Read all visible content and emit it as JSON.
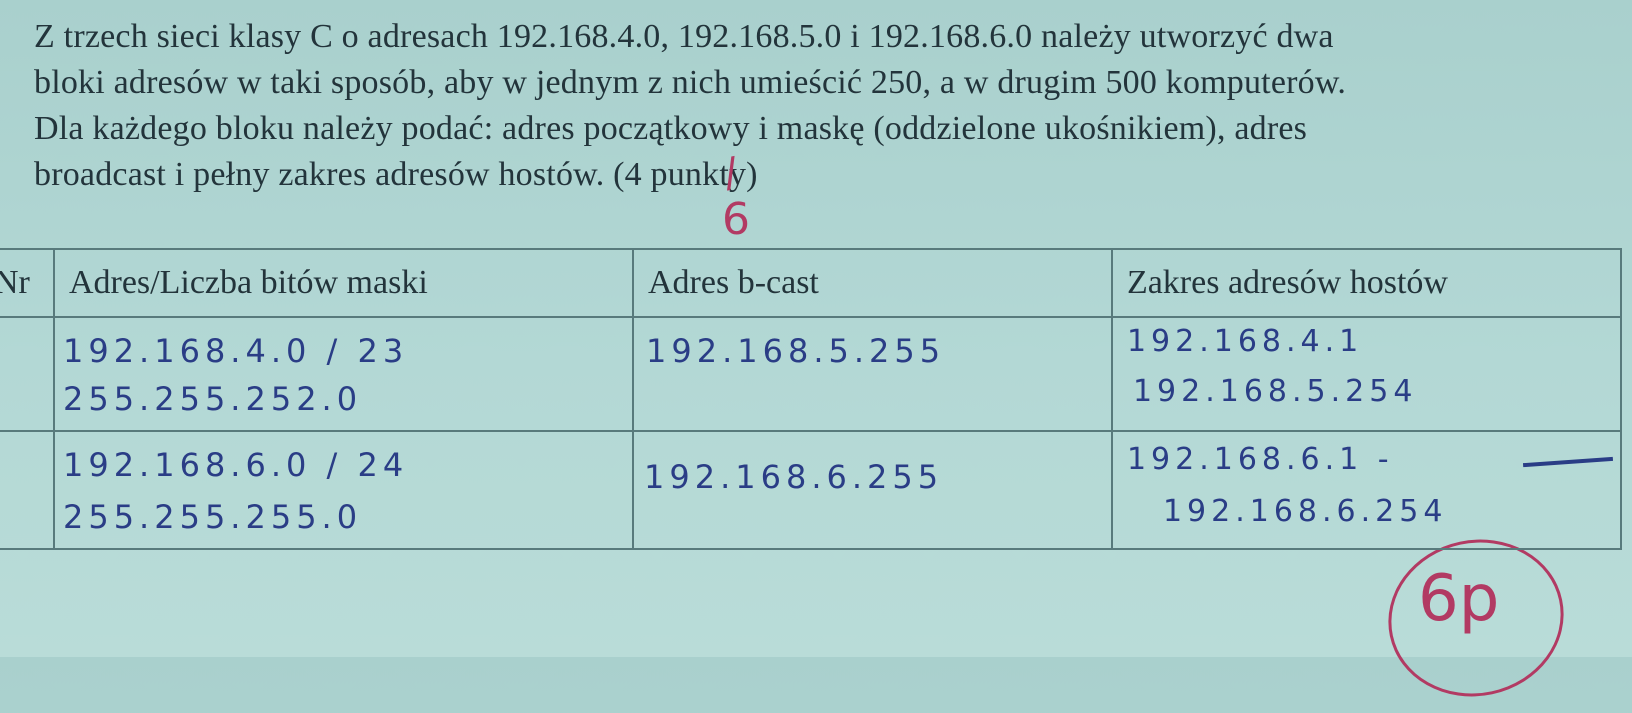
{
  "question": {
    "line1": "Z trzech sieci klasy C o adresach 192.168.4.0, 192.168.5.0 i 192.168.6.0 należy utworzyć dwa",
    "line2": "bloki adresów w taki sposób, aby w jednym z nich umieścić 250, a w drugim 500 komputerów.",
    "line3": "Dla każdego bloku należy podać: adres początkowy i maskę (oddzielone ukośnikiem), adres",
    "line4": "broadcast i pełny zakres adresów hostów. (4 punkty)"
  },
  "grading": {
    "points_correction": "6",
    "score_circled": "6p"
  },
  "table": {
    "headers": [
      "Nr",
      "Adres/Liczba bitów maski",
      "Adres b-cast",
      "Zakres adresów hostów"
    ],
    "rows": [
      {
        "address": "192.168.4.0 / 23",
        "mask": "255.255.252.0",
        "broadcast": "192.168.5.255",
        "host_first": "192.168.4.1",
        "host_last": "192.168.5.254"
      },
      {
        "address": "192.168.6.0 / 24",
        "mask": "255.255.255.0",
        "broadcast": "192.168.6.255",
        "host_first": "192.168.6.1 -",
        "host_last": "192.168.6.254"
      }
    ]
  }
}
